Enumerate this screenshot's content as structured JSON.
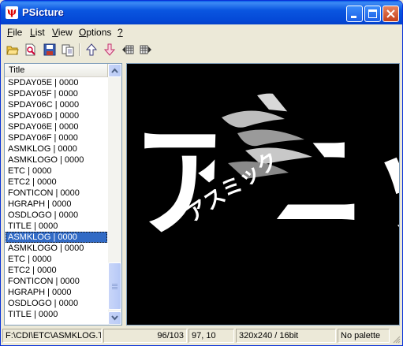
{
  "window": {
    "title": "PSicture"
  },
  "menu": [
    {
      "underline": "F",
      "rest": "ile"
    },
    {
      "underline": "L",
      "rest": "ist"
    },
    {
      "underline": "V",
      "rest": "iew"
    },
    {
      "underline": "O",
      "rest": "ptions"
    },
    {
      "underline": "?",
      "rest": ""
    }
  ],
  "toolbar": {
    "icons": [
      "open-folder-icon",
      "find-file-icon",
      "save-icon",
      "copy-icon",
      "arrow-up-icon",
      "arrow-down-icon",
      "prev-frame-icon",
      "next-frame-icon"
    ]
  },
  "list": {
    "column_header": "Title",
    "rows": [
      "SPDAY05E | 0000",
      "SPDAY05F | 0000",
      "SPDAY06C | 0000",
      "SPDAY06D | 0000",
      "SPDAY06E | 0000",
      "SPDAY06F | 0000",
      "ASMKLOG | 0000",
      "ASMKLOGO | 0000",
      "ETC | 0000",
      "ETC2 | 0000",
      "FONTICON | 0000",
      "HGRAPH | 0000",
      "OSDLOGO | 0000",
      "TITLE | 0000",
      "ASMKLOG | 0000",
      "ASMKLOGO | 0000",
      "ETC | 0000",
      "ETC2 | 0000",
      "FONTICON | 0000",
      "HGRAPH | 0000",
      "OSDLOGO | 0000",
      "TITLE | 0000"
    ],
    "selected_index": 14
  },
  "preview": {
    "big_text": "アニック",
    "small_text": "アスミック"
  },
  "status": {
    "path": "F:\\CDI\\ETC\\ASMKLOG.TI",
    "index": "96/103",
    "coords": "97, 10",
    "format": "320x240 / 16bit",
    "palette": "No palette"
  },
  "colors": {
    "selection": "#316ac5",
    "titlebar": "#0a56e0",
    "close": "#c4401b"
  }
}
